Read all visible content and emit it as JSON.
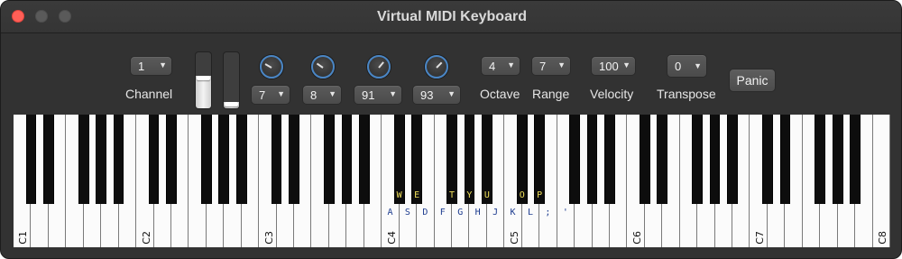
{
  "window": {
    "title": "Virtual MIDI Keyboard",
    "colors": {
      "close": "#ff5f57",
      "knob_accent": "#4a86c5",
      "black_key_label": "#f0e05a",
      "white_key_label": "#1d3c8f"
    }
  },
  "controls": {
    "channel": {
      "value": "1",
      "label": "Channel"
    },
    "sliders": [
      {
        "level": 0.58
      },
      {
        "level": 0.12
      }
    ],
    "knobs": [
      {
        "value": "7",
        "angle": -60
      },
      {
        "value": "8",
        "angle": -55
      },
      {
        "value": "91",
        "angle": 40
      },
      {
        "value": "93",
        "angle": 45
      }
    ],
    "octave": {
      "value": "4",
      "label": "Octave"
    },
    "range": {
      "value": "7",
      "label": "Range"
    },
    "velocity": {
      "value": "100",
      "label": "Velocity"
    },
    "transpose": {
      "value": "0",
      "label": "Transpose"
    },
    "panic_label": "Panic"
  },
  "keyboard": {
    "octave_labels": [
      "C1",
      "C2",
      "C3",
      "C4",
      "C5",
      "C6",
      "C7",
      "C8"
    ],
    "white_key_map": [
      "A",
      "S",
      "D",
      "F",
      "G",
      "H",
      "J",
      "K",
      "L",
      ";",
      "'"
    ],
    "black_key_map": [
      "W",
      "E",
      "T",
      "Y",
      "U",
      "O",
      "P"
    ]
  }
}
